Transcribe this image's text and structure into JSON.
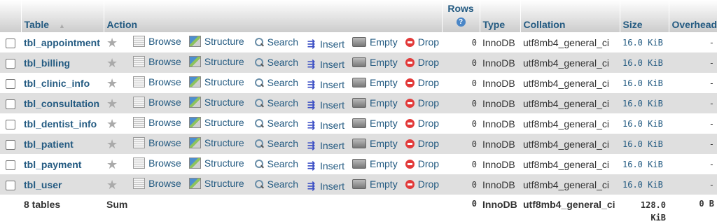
{
  "headers": {
    "table": "Table",
    "action": "Action",
    "rows": "Rows",
    "type": "Type",
    "collation": "Collation",
    "size": "Size",
    "overhead": "Overhead"
  },
  "actions": {
    "browse": "Browse",
    "structure": "Structure",
    "search": "Search",
    "insert": "Insert",
    "empty": "Empty",
    "drop": "Drop"
  },
  "rows": [
    {
      "name": "tbl_appointment",
      "rows": "0",
      "type": "InnoDB",
      "collation": "utf8mb4_general_ci",
      "size": "16.0 KiB",
      "overhead": "-"
    },
    {
      "name": "tbl_billing",
      "rows": "0",
      "type": "InnoDB",
      "collation": "utf8mb4_general_ci",
      "size": "16.0 KiB",
      "overhead": "-"
    },
    {
      "name": "tbl_clinic_info",
      "rows": "0",
      "type": "InnoDB",
      "collation": "utf8mb4_general_ci",
      "size": "16.0 KiB",
      "overhead": "-"
    },
    {
      "name": "tbl_consultation",
      "rows": "0",
      "type": "InnoDB",
      "collation": "utf8mb4_general_ci",
      "size": "16.0 KiB",
      "overhead": "-"
    },
    {
      "name": "tbl_dentist_info",
      "rows": "0",
      "type": "InnoDB",
      "collation": "utf8mb4_general_ci",
      "size": "16.0 KiB",
      "overhead": "-"
    },
    {
      "name": "tbl_patient",
      "rows": "0",
      "type": "InnoDB",
      "collation": "utf8mb4_general_ci",
      "size": "16.0 KiB",
      "overhead": "-"
    },
    {
      "name": "tbl_payment",
      "rows": "0",
      "type": "InnoDB",
      "collation": "utf8mb4_general_ci",
      "size": "16.0 KiB",
      "overhead": "-"
    },
    {
      "name": "tbl_user",
      "rows": "0",
      "type": "InnoDB",
      "collation": "utf8mb4_general_ci",
      "size": "16.0 KiB",
      "overhead": "-"
    }
  ],
  "footer": {
    "count": "8 tables",
    "sum": "Sum",
    "rows": "0",
    "type": "InnoDB",
    "collation": "utf8mb4_general_ci",
    "size_line1": "128.0",
    "size_line2": "KiB",
    "overhead": "0 B"
  },
  "icons": {
    "favorite": "star-icon",
    "browse": "browse-icon",
    "structure": "structure-icon",
    "search": "search-icon",
    "insert": "insert-icon",
    "empty": "empty-icon",
    "drop": "drop-icon",
    "help": "help-icon"
  }
}
